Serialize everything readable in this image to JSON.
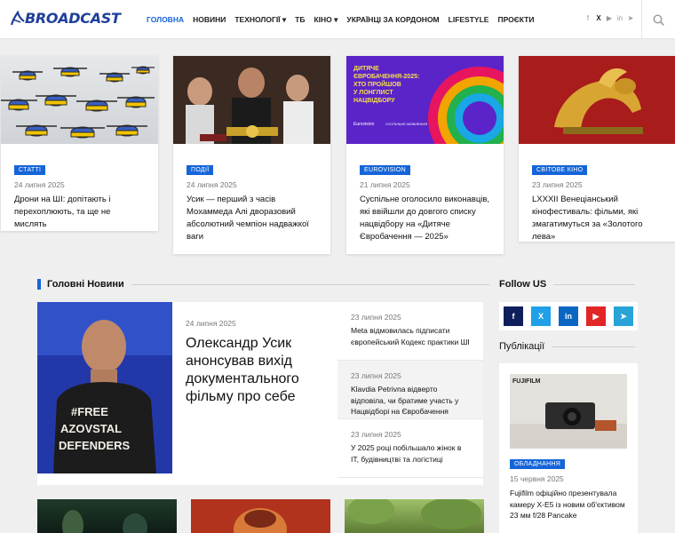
{
  "brand": {
    "name": "BROADCAST",
    "accent": "#1565d8",
    "navy": "#1f3f9b"
  },
  "nav": [
    {
      "label": "ГОЛОВНА",
      "active": true
    },
    {
      "label": "НОВИНИ"
    },
    {
      "label": "ТЕХНОЛОГІЇ ▾"
    },
    {
      "label": "ТБ"
    },
    {
      "label": "КІНО ▾"
    },
    {
      "label": "УКРАЇНЦІ ЗА КОРДОНОМ"
    },
    {
      "label": "LIFESTYLE"
    },
    {
      "label": "ПРОЄКТИ"
    }
  ],
  "socials": [
    "f",
    "X",
    "▶",
    "in",
    "➤"
  ],
  "featured": [
    {
      "tag": "СТАТТІ",
      "date": "24 липня 2025",
      "title": "Дрони на ШІ: допітають і перехоплюють, та ще не мислять"
    },
    {
      "tag": "ПОДІЇ",
      "date": "24 липня 2025",
      "title": "Усик — перший з часів Мохаммеда Алі дворазовий абсолютний чемпіон надважкої ваги"
    },
    {
      "tag": "EUROVISION",
      "date": "21 липня 2025",
      "title": "Суспільне оголосило виконавців, які ввійшли до довгого списку нацвідбору на «Дитяче Євробачення — 2025»"
    },
    {
      "tag": "СВІТОВЕ КІНО",
      "date": "23 липня 2025",
      "title": "LXXXII Венеціанський кінофестиваль: фільми, які змагатимуться за «Золотого лева»"
    }
  ],
  "banner_text": [
    "ДИТЯЧЕ",
    "ЄВРОБАЧЕННЯ-2025:",
    "ХТО ПРОЙШОВ",
    "У ЛОНГЛИСТ",
    "НАЦВІДБОРУ"
  ],
  "banner_logos": [
    "Eurovision",
    "СУСПІЛЬНЕ МОВЛЕННЯ"
  ],
  "main_news": {
    "heading": "Головні Новини",
    "lead": {
      "date": "24 липня 2025",
      "title": "Олександр Усик анонсував вихід документального фільму про себе",
      "shirt": [
        "#FREE",
        "AZOVSTAL",
        "DEFENDERS"
      ]
    },
    "list": [
      {
        "date": "23 липня 2025",
        "title": "Meta відмовилась підписати європейський Кодекс практики ШІ"
      },
      {
        "date": "23 липня 2025",
        "title": "Klavdia Petrivna відверто відповіла, чи братиме участь у Нацвідборі на Євробачення"
      },
      {
        "date": "23 липня 2025",
        "title": "У 2025 році побільшало жінок в ІТ, будівництві та логістиці"
      }
    ]
  },
  "sidebar": {
    "follow_heading": "Follow US",
    "follow_buttons": [
      "f",
      "X",
      "in",
      "▶",
      "➤"
    ],
    "pub_heading": "Публікації",
    "pub": {
      "brand": "FUJIFILM",
      "tag": "ОБЛАДНАННЯ",
      "date": "15 червня 2025",
      "title": "Fujifilm офіційно презентувала камеру X-E5 із новим об'єктивом 23 мм f/28 Pancake"
    }
  }
}
